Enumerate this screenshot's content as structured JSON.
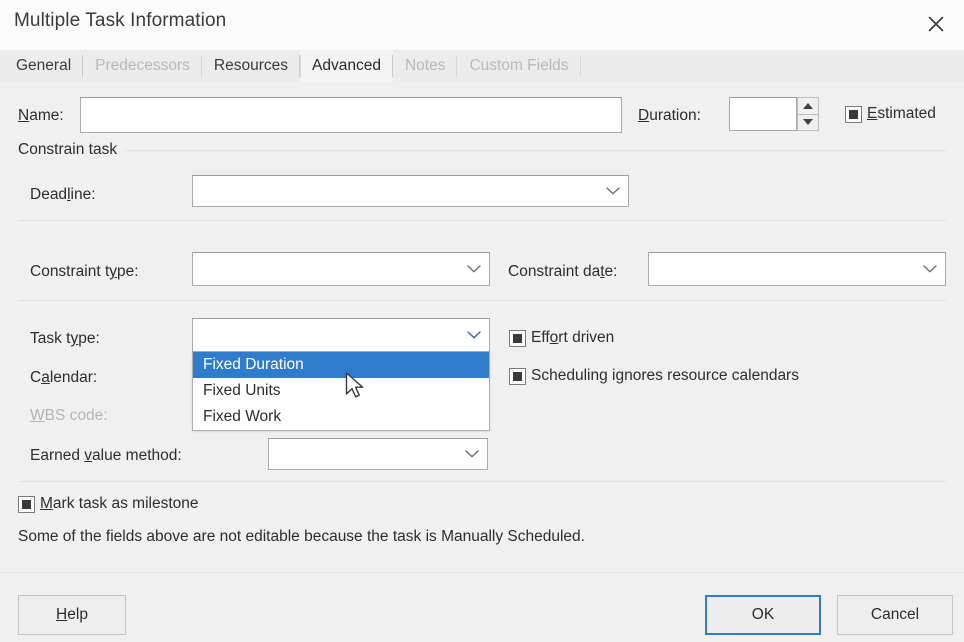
{
  "window": {
    "title": "Multiple Task Information",
    "close_icon": "close-icon"
  },
  "tabs": [
    {
      "label": "General",
      "state": "enabled",
      "active": false
    },
    {
      "label": "Predecessors",
      "state": "disabled",
      "active": false
    },
    {
      "label": "Resources",
      "state": "enabled",
      "active": false
    },
    {
      "label": "Advanced",
      "state": "enabled",
      "active": true
    },
    {
      "label": "Notes",
      "state": "disabled",
      "active": false
    },
    {
      "label": "Custom Fields",
      "state": "disabled",
      "active": false
    }
  ],
  "form": {
    "name_label": "Name:",
    "name_value": "",
    "duration_label": "Duration:",
    "duration_value": "",
    "estimated_label": "Estimated",
    "estimated_state": "indeterminate",
    "group_caption": "Constrain task",
    "deadline_label": "Deadline:",
    "deadline_value": "",
    "constraint_type_label": "Constraint type:",
    "constraint_type_value": "",
    "constraint_date_label": "Constraint date:",
    "constraint_date_value": "",
    "task_type_label": "Task type:",
    "task_type_value": "",
    "calendar_label": "Calendar:",
    "calendar_value": "",
    "wbs_code_label": "WBS code:",
    "wbs_code_state": "disabled",
    "earned_value_label": "Earned value method:",
    "earned_value_value": "",
    "effort_driven_label": "Effort driven",
    "effort_driven_state": "indeterminate",
    "scheduling_ignores_label": "Scheduling ignores resource calendars",
    "scheduling_ignores_state": "indeterminate",
    "milestone_label": "Mark task as milestone",
    "milestone_state": "indeterminate",
    "note": "Some of the fields above are not editable because the task is Manually Scheduled."
  },
  "task_type_dropdown": {
    "open": true,
    "options": [
      "Fixed Duration",
      "Fixed Units",
      "Fixed Work"
    ],
    "highlighted": "Fixed Duration"
  },
  "footer": {
    "help_label": "Help",
    "ok_label": "OK",
    "cancel_label": "Cancel",
    "focused_button": "OK"
  },
  "colors": {
    "accent": "#2f7ccc",
    "dialog_bg": "#f0f0f0",
    "titlebar_bg": "#fbfbfb",
    "tabstrip_bg": "#ececec",
    "active_tab_bg": "#f4f4f4",
    "field_bg": "#ffffff",
    "field_border": "#a9a9a9",
    "disabled_text": "#b4b4b4",
    "text": "#2d2d2d"
  }
}
